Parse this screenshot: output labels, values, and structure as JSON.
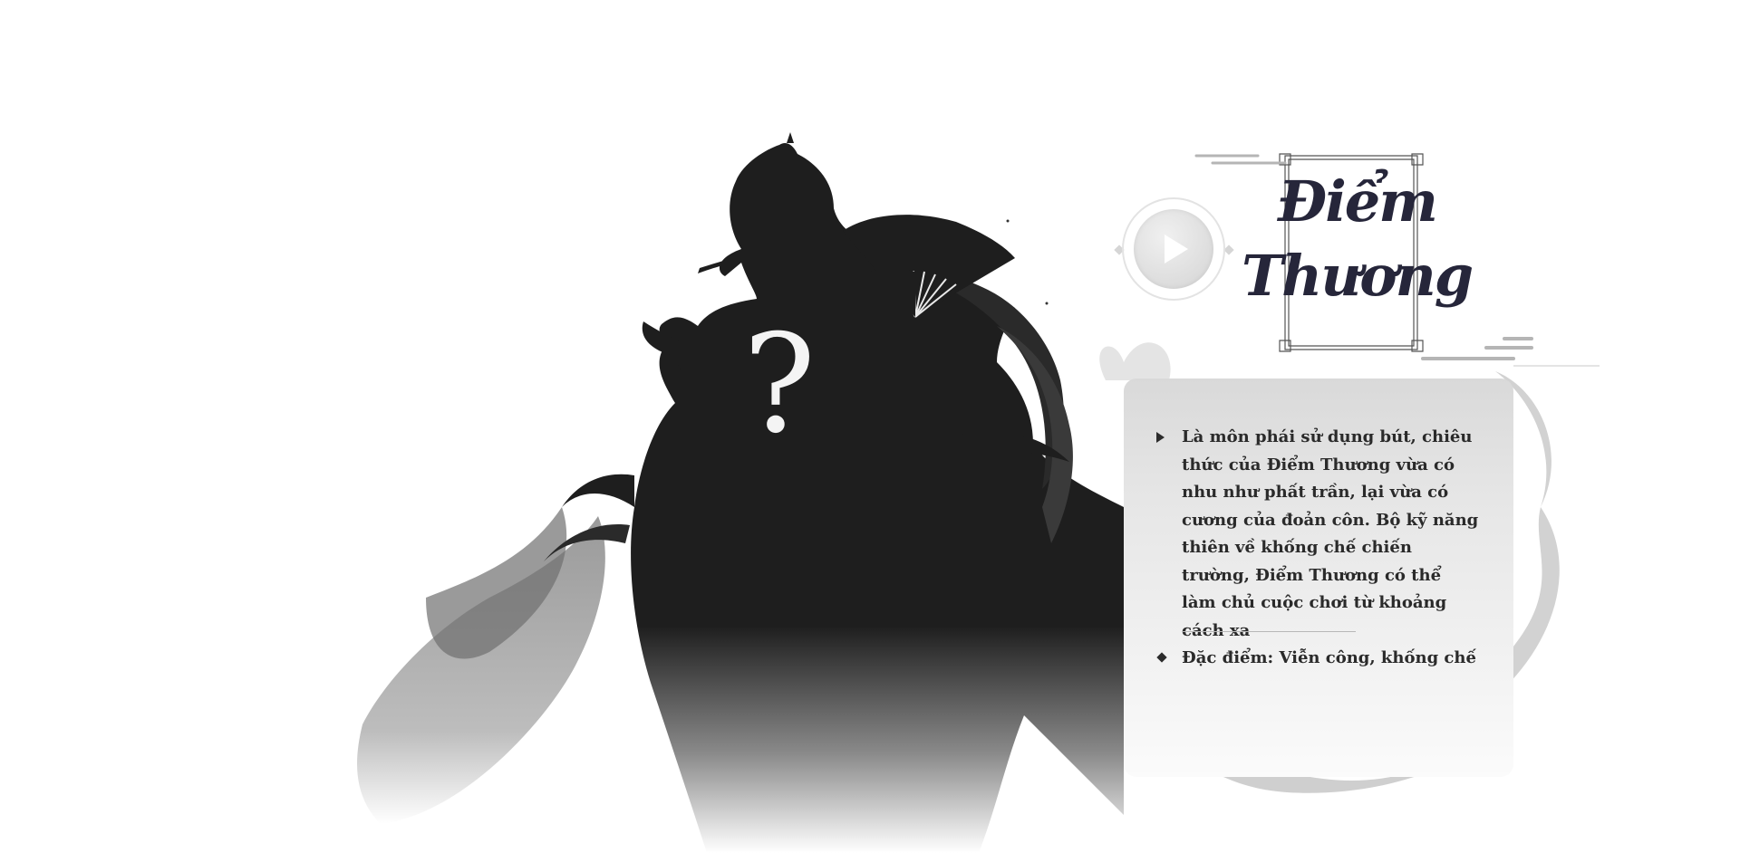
{
  "character": {
    "name_line1": "Điểm",
    "name_line2": "Thương",
    "mystery_symbol": "?",
    "description": "Là môn phái sử dụng bút, chiêu thức của Điểm Thương vừa có nhu như phất trần, lại vừa có cương của đoản côn. Bộ kỹ năng thiên về khống chế chiến trường, Điểm Thương có thể làm chủ cuộc chơi từ khoảng cách xa",
    "feature": "Đặc điểm: Viễn công, khống chế"
  },
  "icons": {
    "play": "play-icon",
    "description_bullet": "arrow-bullet-icon",
    "feature_bullet": "diamond-bullet-icon"
  },
  "colors": {
    "silhouette": "#1e1e1e",
    "title": "#26263a",
    "text": "#2a2a2a",
    "panel_top": "#d9d9d9",
    "background": "#ffffff"
  }
}
